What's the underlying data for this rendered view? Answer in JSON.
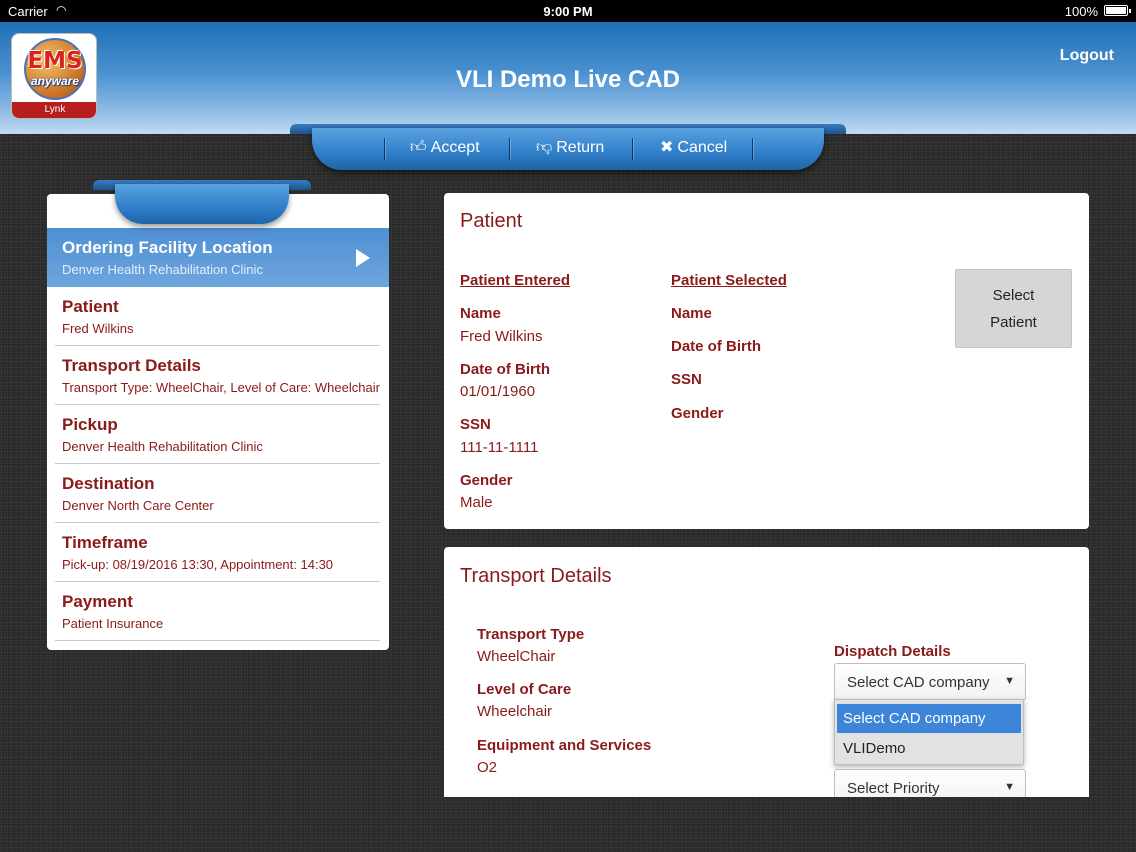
{
  "status_bar": {
    "carrier": "Carrier",
    "time": "9:00 PM",
    "battery": "100%"
  },
  "header": {
    "logo_text": "EMS",
    "logo_sub": "anyware",
    "logo_badge": "Lynk",
    "title": "VLI Demo Live CAD",
    "logout_label": "Logout"
  },
  "toolbar": {
    "accept_label": "Accept",
    "return_label": "Return",
    "cancel_label": "Cancel",
    "accept_icon": "thumbs-up-icon",
    "return_icon": "thumbs-down-icon",
    "cancel_icon": "close-icon"
  },
  "nav": {
    "items": [
      {
        "title": "Ordering Facility Location",
        "sub": "Denver Health Rehabilitation Clinic",
        "active": true
      },
      {
        "title": "Patient",
        "sub": "Fred Wilkins"
      },
      {
        "title": "Transport Details",
        "sub": "Transport Type: WheelChair, Level of Care: Wheelchair"
      },
      {
        "title": "Pickup",
        "sub": "Denver Health Rehabilitation Clinic"
      },
      {
        "title": "Destination",
        "sub": "Denver North Care Center"
      },
      {
        "title": "Timeframe",
        "sub": "Pick-up: 08/19/2016 13:30, Appointment: 14:30"
      },
      {
        "title": "Payment",
        "sub": "Patient Insurance"
      }
    ]
  },
  "patient": {
    "title": "Patient",
    "entered_heading": "Patient Entered",
    "selected_heading": "Patient Selected",
    "labels": {
      "name": "Name",
      "dob": "Date of Birth",
      "ssn": "SSN",
      "gender": "Gender"
    },
    "entered": {
      "name": "Fred Wilkins",
      "dob": "01/01/1960",
      "ssn": "111-11-1111",
      "gender": "Male"
    },
    "select_button_line1": "Select",
    "select_button_line2": "Patient"
  },
  "transport": {
    "title": "Transport Details",
    "transport_type_label": "Transport Type",
    "transport_type_value": "WheelChair",
    "level_of_care_label": "Level of Care",
    "level_of_care_value": "Wheelchair",
    "equipment_label": "Equipment and Services",
    "equipment_value": "O2",
    "dispatch_label": "Dispatch Details",
    "cad_select_value": "Select CAD company",
    "cad_options": [
      "Select CAD company",
      "VLIDemo"
    ],
    "priority_select_value": "Select Priority"
  },
  "colors": {
    "accent_dark_red": "#8b1a1a",
    "header_blue": "#2f7ec8",
    "selection_blue": "#3d85d8"
  }
}
